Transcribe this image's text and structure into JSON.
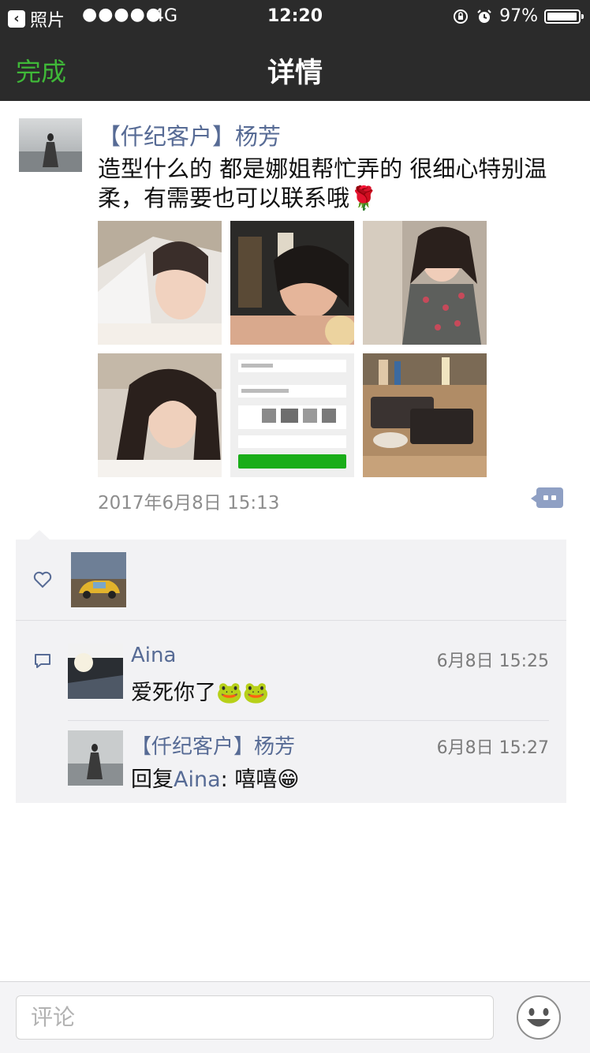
{
  "status_bar": {
    "back_app": "照片",
    "signal": "●●●●●",
    "network": "4G",
    "time": "12:20",
    "battery": "97%",
    "battery_level": 0.97
  },
  "nav": {
    "done": "完成",
    "title": "详情"
  },
  "post": {
    "author": "【仟纪客户】杨芳",
    "text": "造型什么的 都是娜姐帮忙弄的 很细心特别温柔，有需要也可以联系哦🌹",
    "timestamp": "2017年6月8日 15:13",
    "photos": [
      "photo-bride-veil",
      "photo-bride-night",
      "photo-girl-dress",
      "photo-selfie-hair",
      "photo-app-screenshot",
      "photo-table-bags"
    ]
  },
  "likes": {
    "users": [
      "liker-car-avatar"
    ]
  },
  "comments": [
    {
      "name": "Aina",
      "time": "6月8日 15:25",
      "text": "爱死你了🐸🐸"
    },
    {
      "name": "【仟纪客户】杨芳",
      "time": "6月8日 15:27",
      "reply_prefix": "回复",
      "reply_to": "Aina",
      "text": ": 嘻嘻😁"
    }
  ],
  "input": {
    "placeholder": "评论"
  },
  "colors": {
    "bar": "#2b2b2b",
    "accent_green": "#3fb838",
    "link_blue": "#576b95",
    "panel": "#f2f2f4"
  }
}
